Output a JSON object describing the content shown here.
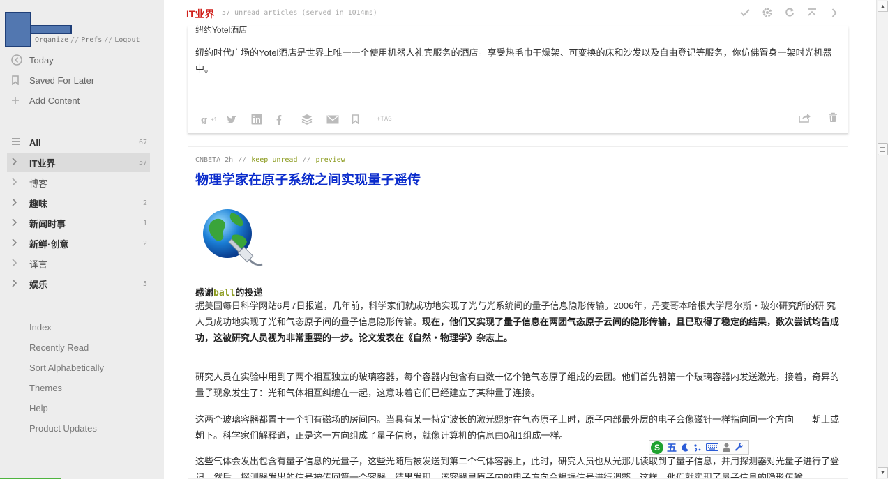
{
  "sidebar": {
    "toplinks": [
      "Organize",
      "Prefs",
      "Logout"
    ],
    "menu": [
      {
        "label": "Today",
        "icon": "today-icon"
      },
      {
        "label": "Saved For Later",
        "icon": "bookmark-icon"
      },
      {
        "label": "Add Content",
        "icon": "plus-icon"
      }
    ],
    "feeds": [
      {
        "label": "All",
        "count": "67",
        "bold": true,
        "icon": "list-icon"
      },
      {
        "label": "IT业界",
        "count": "57",
        "bold": true,
        "active": true
      },
      {
        "label": "博客",
        "count": "",
        "bold": false
      },
      {
        "label": "趣味",
        "count": "2",
        "bold": true
      },
      {
        "label": "新闻时事",
        "count": "1",
        "bold": true
      },
      {
        "label": "新鲜·创意",
        "count": "2",
        "bold": true
      },
      {
        "label": "译言",
        "count": "",
        "bold": false
      },
      {
        "label": "娱乐",
        "count": "5",
        "bold": true
      }
    ],
    "bottom_links": [
      "Index",
      "Recently Read",
      "Sort Alphabetically",
      "Themes",
      "Help",
      "Product Updates"
    ]
  },
  "header": {
    "feed_title": "IT业界",
    "unread_info": "57 unread articles (served in 1014ms)"
  },
  "article1": {
    "cut_title": "纽约Yotel酒店",
    "body": "纽约时代广场的Yotel酒店是世界上唯一一个使用机器人礼宾服务的酒店。享受热毛巾干燥架、可变换的床和沙发以及自由登记等服务，你仿佛置身一架时光机器中。",
    "gplus_label": "+1",
    "tag_label": "+TAG"
  },
  "article2": {
    "source": "CNBETA",
    "age": "2h",
    "keep_unread": "keep unread",
    "preview": "preview",
    "title": "物理学家在原子系统之间实现量子遥传",
    "thanks_prefix": "感谢",
    "thanks_user": "ball",
    "thanks_suffix": "的投递",
    "p1": "据美国每日科学网站6月7日报道，几年前，科学家们就成功地实现了光与光系统间的量子信息隐形传输。2006年，丹麦哥本哈根大学尼尔斯・玻尔研究所的研 究人员成功地实现了光和气态原子间的量子信息隐形传输。",
    "p1_bold": "现在，他们又实现了量子信息在两团气态原子云间的隐形传输，且已取得了稳定的结果，数次尝试均告成 功，这被研究人员视为非常重要的一步。论文发表在《自然・物理学》杂志上。",
    "p2": "研究人员在实验中用到了两个相互独立的玻璃容器，每个容器内包含有由数十亿个铯气态原子组成的云团。他们首先朝第一个玻璃容器内发送激光，接着，奇异的量子现象发生了：光和气体相互纠缠在一起，这意味着它们已经建立了某种量子连接。",
    "p3": "这两个玻璃容器都置于一个拥有磁场的房间内。当具有某一特定波长的激光照射在气态原子上时，原子内部最外层的电子会像磁针一样指向同一个方向——朝上或朝下。科学家们解释道，正是这一方向组成了量子信息，就像计算机的信息由0和1组成一样。",
    "p4": "这些气体会发出包含有量子信息的光量子，这些光随后被发送到第二个气体容器上，此时，研究人员也从光那儿读取到了量子信息，并用探测器对光量子进行了登记。然后，探测器发出的信号被传回第一个容器，结果发现，该容器里原子内的电子方向会根据信号进行调整。这样，他们就实现了量子信息的隐形传输。"
  },
  "ime": {
    "logo": "S",
    "mode": "五"
  },
  "colors": {
    "feed_title": "#d0211c",
    "article_title": "#0b2ccc",
    "accent_green": "#8a9a1c",
    "sidebar_bg": "#ededed"
  }
}
